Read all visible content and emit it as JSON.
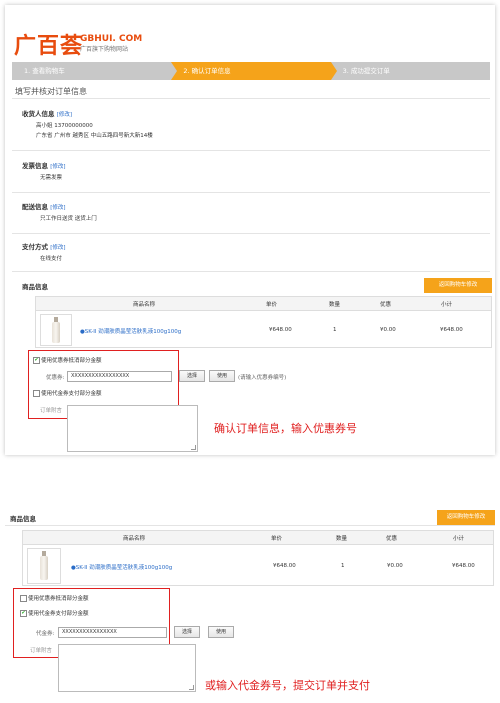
{
  "logo": {
    "brand_cn": "广百荟",
    "brand_en": "GBHUI. COM",
    "tagline": "广百旗下购物网站"
  },
  "steps": [
    {
      "label": "1. 查看购物车",
      "active": false
    },
    {
      "label": "2. 确认订单信息",
      "active": true
    },
    {
      "label": "3. 成功提交订单",
      "active": false
    }
  ],
  "page_title": "填写并核对订单信息",
  "consignee": {
    "heading": "收货人信息",
    "edit": "[修改]",
    "name_phone": "高小姐  13700000000",
    "address": "广东省  广州市  越秀区  中山五路四号新大新14楼"
  },
  "invoice": {
    "heading": "发票信息",
    "edit": "[修改]",
    "value": "无需发票"
  },
  "delivery": {
    "heading": "配送信息",
    "edit": "[修改]",
    "value": "只工作日送货   送货上门"
  },
  "payment": {
    "heading": "支付方式",
    "edit": "[修改]",
    "value": "在线支付"
  },
  "goods": {
    "heading": "商品信息",
    "back_button": "返回购物车修改",
    "columns": [
      "商品名称",
      "单价",
      "数量",
      "优惠",
      "小计"
    ],
    "row": {
      "name": "●SK-II 劲潮肤质晶莹活肤乳液100g100g",
      "price": "¥648.00",
      "qty": "1",
      "discount": "¥0.00",
      "subtotal": "¥648.00"
    }
  },
  "form1": {
    "coupon_checkbox": "使用优惠券抵消部分金额",
    "coupon_checked": true,
    "coupon_label": "优惠券:",
    "coupon_value": "XXXXXXXXXXXXXXXXX",
    "select_btn": "选择",
    "use_btn": "使用",
    "hint": "(请输入优惠券编号)",
    "voucher_checkbox": "使用代金券支付部分金额",
    "voucher_checked": false,
    "remark_label": "订单附言"
  },
  "note1": "确认订单信息，输入优惠券号",
  "form2": {
    "coupon_checkbox": "使用优惠券抵消部分金额",
    "coupon_checked": false,
    "voucher_checkbox": "使用代金券支付部分金额",
    "voucher_checked": true,
    "voucher_label": "代金券:",
    "voucher_value": "XXXXXXXXXXXXXXXX",
    "select_btn": "选择",
    "use_btn": "使用",
    "remark_label": "订单附言"
  },
  "note2": "或输入代金券号，提交订单并支付",
  "colors": {
    "accent": "#f5a31a",
    "brand": "#e84c0e",
    "highlight": "#e02020",
    "link": "#2a6cc7"
  }
}
